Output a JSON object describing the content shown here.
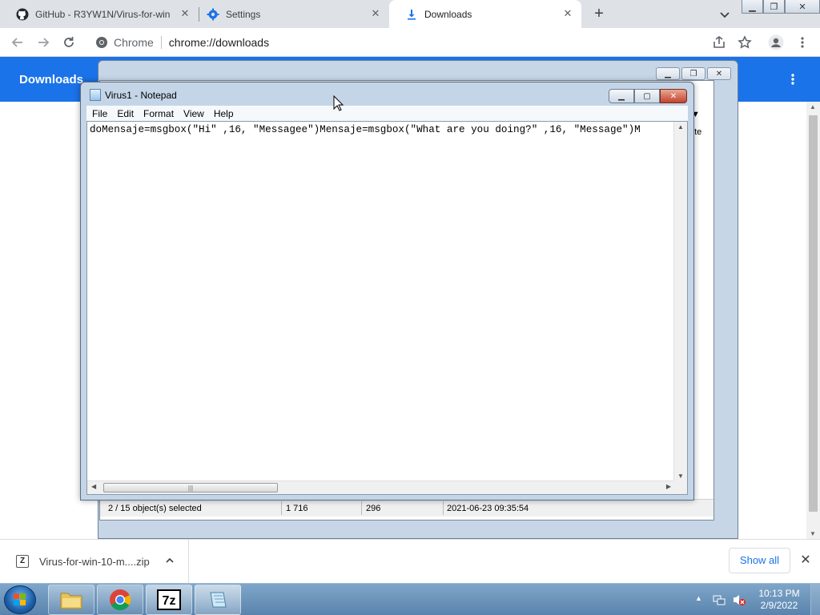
{
  "tabs": [
    {
      "title": "GitHub - R3YW1N/Virus-for-win",
      "icon": "github-icon"
    },
    {
      "title": "Settings",
      "icon": "gear-icon"
    },
    {
      "title": "Downloads",
      "icon": "download-icon"
    }
  ],
  "toolbar": {
    "site_chip": "Chrome",
    "url": "chrome://downloads"
  },
  "downloads_page": {
    "title": "Downloads"
  },
  "notepad": {
    "title": "Virus1 - Notepad",
    "menu": [
      "File",
      "Edit",
      "Format",
      "View",
      "Help"
    ],
    "content": "doMensaje=msgbox(\"Hi\" ,16, \"Messagee\")Mensaje=msgbox(\"What are you doing?\" ,16, \"Message\")M"
  },
  "background_window": {
    "header_fragment": "ute",
    "status": {
      "selected": "2 / 15 object(s) selected",
      "size": "1 716",
      "packed": "296",
      "modified": "2021-06-23 09:35:54"
    }
  },
  "shelf": {
    "filename": "Virus-for-win-10-m....zip",
    "show_all": "Show all"
  },
  "taskbar": {
    "time": "10:13 PM",
    "date": "2/9/2022"
  },
  "colors": {
    "chrome_blue": "#1a73e8",
    "tabstrip": "#dee1e6",
    "taskbar": "#5a84ad"
  }
}
